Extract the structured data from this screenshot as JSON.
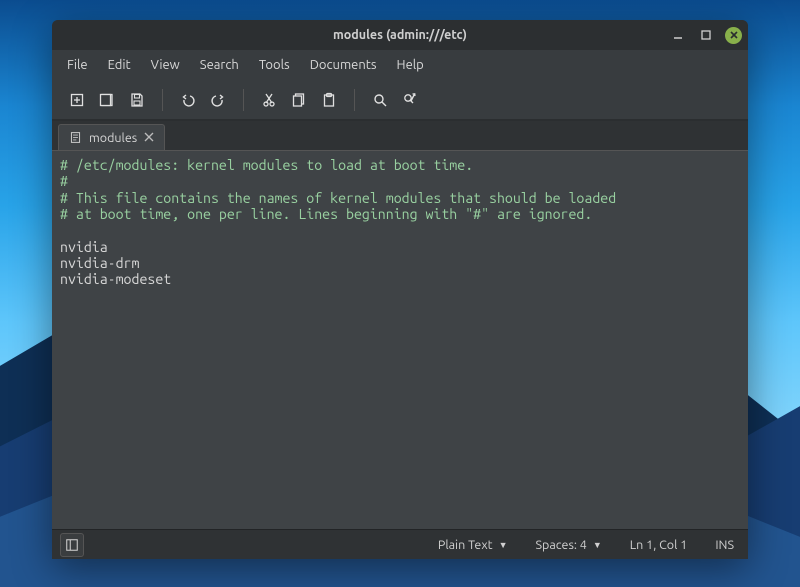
{
  "window": {
    "title": "modules (admin:///etc)"
  },
  "menubar": [
    "File",
    "Edit",
    "View",
    "Search",
    "Tools",
    "Documents",
    "Help"
  ],
  "tabs": [
    {
      "label": "modules"
    }
  ],
  "editor": {
    "lines": [
      "# /etc/modules: kernel modules to load at boot time.",
      "#",
      "# This file contains the names of kernel modules that should be loaded",
      "# at boot time, one per line. Lines beginning with \"#\" are ignored.",
      "",
      "nvidia",
      "nvidia-drm",
      "nvidia-modeset"
    ]
  },
  "statusbar": {
    "mode": "Plain Text",
    "spaces": "Spaces: 4",
    "position": "Ln 1, Col 1",
    "insert": "INS"
  },
  "icons": {
    "new": "new-file-icon",
    "open": "open-icon",
    "save": "save-icon",
    "undo": "undo-icon",
    "redo": "redo-icon",
    "cut": "cut-icon",
    "copy": "copy-icon",
    "paste": "paste-icon",
    "search": "search-icon",
    "replace": "replace-icon"
  }
}
